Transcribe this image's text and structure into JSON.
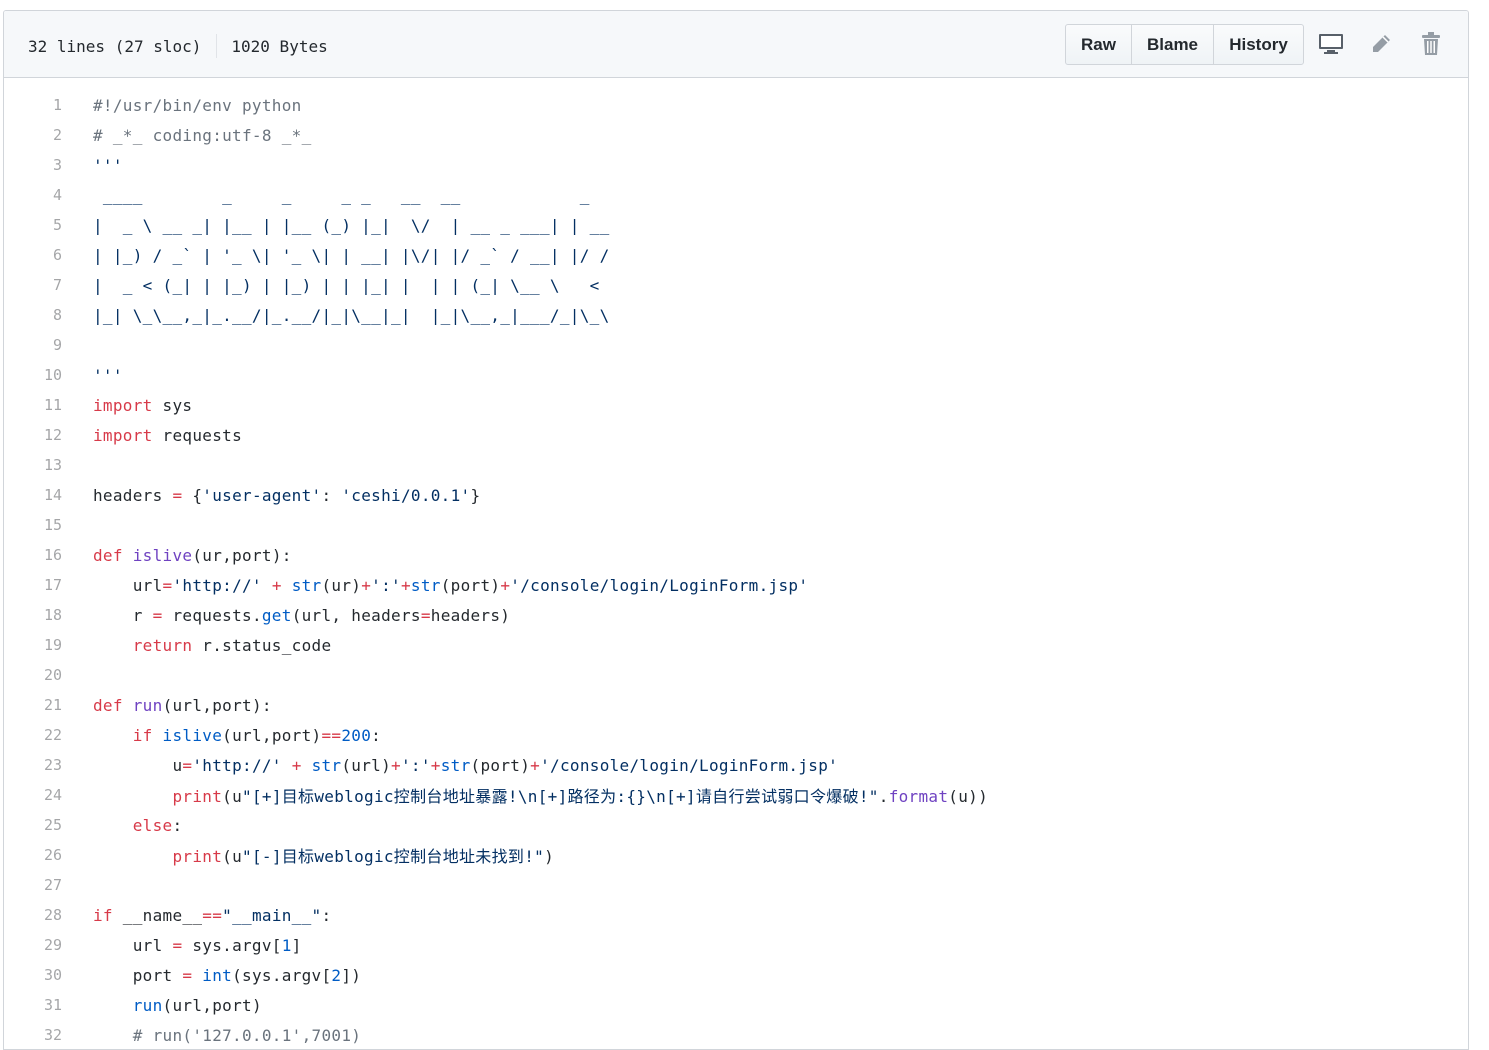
{
  "file_info": {
    "lines": "32 lines (27 sloc)",
    "size": "1020 Bytes"
  },
  "toolbar": {
    "raw": "Raw",
    "blame": "Blame",
    "history": "History"
  },
  "icons": {
    "desktop": "desktop-icon",
    "edit": "pencil-icon",
    "delete": "trash-icon"
  },
  "code_lines": [
    [
      {
        "t": "com",
        "v": "#!/usr/bin/env python"
      }
    ],
    [
      {
        "t": "com",
        "v": "# _*_ coding:utf-8 _*_"
      }
    ],
    [
      {
        "t": "str",
        "v": "'''"
      }
    ],
    [
      {
        "t": "str",
        "v": " ____        _     _     _ _   __  __            _"
      }
    ],
    [
      {
        "t": "str",
        "v": "|  _ \\ __ _| |__ | |__ (_) |_|  \\/  | __ _ ___| | __"
      }
    ],
    [
      {
        "t": "str",
        "v": "| |_) / _` | '_ \\| '_ \\| | __| |\\/| |/ _` / __| |/ /"
      }
    ],
    [
      {
        "t": "str",
        "v": "|  _ < (_| | |_) | |_) | | |_| |  | | (_| \\__ \\   <"
      }
    ],
    [
      {
        "t": "str",
        "v": "|_| \\_\\__,_|_.__/|_.__/|_|\\__|_|  |_|\\__,_|___/_|\\_\\"
      }
    ],
    [],
    [
      {
        "t": "str",
        "v": "'''"
      }
    ],
    [
      {
        "t": "kw",
        "v": "import"
      },
      {
        "t": "",
        "v": " sys"
      }
    ],
    [
      {
        "t": "kw",
        "v": "import"
      },
      {
        "t": "",
        "v": " requests"
      }
    ],
    [],
    [
      {
        "t": "",
        "v": "headers "
      },
      {
        "t": "op",
        "v": "="
      },
      {
        "t": "",
        "v": " {"
      },
      {
        "t": "str",
        "v": "'user-agent'"
      },
      {
        "t": "",
        "v": ": "
      },
      {
        "t": "str",
        "v": "'ceshi/0.0.1'"
      },
      {
        "t": "",
        "v": "}"
      }
    ],
    [],
    [
      {
        "t": "kw",
        "v": "def"
      },
      {
        "t": "",
        "v": " "
      },
      {
        "t": "fn",
        "v": "islive"
      },
      {
        "t": "",
        "v": "(ur,port):"
      }
    ],
    [
      {
        "t": "",
        "v": "    url"
      },
      {
        "t": "op",
        "v": "="
      },
      {
        "t": "str",
        "v": "'http://'"
      },
      {
        "t": "",
        "v": " "
      },
      {
        "t": "op",
        "v": "+"
      },
      {
        "t": "",
        "v": " "
      },
      {
        "t": "bi",
        "v": "str"
      },
      {
        "t": "",
        "v": "(ur)"
      },
      {
        "t": "op",
        "v": "+"
      },
      {
        "t": "str",
        "v": "':'"
      },
      {
        "t": "op",
        "v": "+"
      },
      {
        "t": "bi",
        "v": "str"
      },
      {
        "t": "",
        "v": "(port)"
      },
      {
        "t": "op",
        "v": "+"
      },
      {
        "t": "str",
        "v": "'/console/login/LoginForm.jsp'"
      }
    ],
    [
      {
        "t": "",
        "v": "    r "
      },
      {
        "t": "op",
        "v": "="
      },
      {
        "t": "",
        "v": " requests."
      },
      {
        "t": "bi",
        "v": "get"
      },
      {
        "t": "",
        "v": "(url, headers"
      },
      {
        "t": "op",
        "v": "="
      },
      {
        "t": "",
        "v": "headers)"
      }
    ],
    [
      {
        "t": "",
        "v": "    "
      },
      {
        "t": "kw",
        "v": "return"
      },
      {
        "t": "",
        "v": " r.status_code"
      }
    ],
    [],
    [
      {
        "t": "kw",
        "v": "def"
      },
      {
        "t": "",
        "v": " "
      },
      {
        "t": "fn",
        "v": "run"
      },
      {
        "t": "",
        "v": "(url,port):"
      }
    ],
    [
      {
        "t": "",
        "v": "    "
      },
      {
        "t": "kw",
        "v": "if"
      },
      {
        "t": "",
        "v": " "
      },
      {
        "t": "bi",
        "v": "islive"
      },
      {
        "t": "",
        "v": "(url,port)"
      },
      {
        "t": "op",
        "v": "=="
      },
      {
        "t": "num",
        "v": "200"
      },
      {
        "t": "",
        "v": ":"
      }
    ],
    [
      {
        "t": "",
        "v": "        u"
      },
      {
        "t": "op",
        "v": "="
      },
      {
        "t": "str",
        "v": "'http://'"
      },
      {
        "t": "",
        "v": " "
      },
      {
        "t": "op",
        "v": "+"
      },
      {
        "t": "",
        "v": " "
      },
      {
        "t": "bi",
        "v": "str"
      },
      {
        "t": "",
        "v": "(url)"
      },
      {
        "t": "op",
        "v": "+"
      },
      {
        "t": "str",
        "v": "':'"
      },
      {
        "t": "op",
        "v": "+"
      },
      {
        "t": "bi",
        "v": "str"
      },
      {
        "t": "",
        "v": "(port)"
      },
      {
        "t": "op",
        "v": "+"
      },
      {
        "t": "str",
        "v": "'/console/login/LoginForm.jsp'"
      }
    ],
    [
      {
        "t": "",
        "v": "        "
      },
      {
        "t": "kw",
        "v": "print"
      },
      {
        "t": "",
        "v": "(u"
      },
      {
        "t": "str",
        "v": "\"[+]目标weblogic控制台地址暴露!\\n[+]路径为:{}\\n[+]请自行尝试弱口令爆破!\""
      },
      {
        "t": "",
        "v": "."
      },
      {
        "t": "fn",
        "v": "format"
      },
      {
        "t": "",
        "v": "(u))"
      }
    ],
    [
      {
        "t": "",
        "v": "    "
      },
      {
        "t": "kw",
        "v": "else"
      },
      {
        "t": "",
        "v": ":"
      }
    ],
    [
      {
        "t": "",
        "v": "        "
      },
      {
        "t": "kw",
        "v": "print"
      },
      {
        "t": "",
        "v": "(u"
      },
      {
        "t": "str",
        "v": "\"[-]目标weblogic控制台地址未找到!\""
      },
      {
        "t": "",
        "v": ")"
      }
    ],
    [],
    [
      {
        "t": "kw",
        "v": "if"
      },
      {
        "t": "",
        "v": " __name__"
      },
      {
        "t": "op",
        "v": "=="
      },
      {
        "t": "str",
        "v": "\"__main__\""
      },
      {
        "t": "",
        "v": ":"
      }
    ],
    [
      {
        "t": "",
        "v": "    url "
      },
      {
        "t": "op",
        "v": "="
      },
      {
        "t": "",
        "v": " sys.argv["
      },
      {
        "t": "num",
        "v": "1"
      },
      {
        "t": "",
        "v": "]"
      }
    ],
    [
      {
        "t": "",
        "v": "    port "
      },
      {
        "t": "op",
        "v": "="
      },
      {
        "t": "",
        "v": " "
      },
      {
        "t": "bi",
        "v": "int"
      },
      {
        "t": "",
        "v": "(sys.argv["
      },
      {
        "t": "num",
        "v": "2"
      },
      {
        "t": "",
        "v": "])"
      }
    ],
    [
      {
        "t": "",
        "v": "    "
      },
      {
        "t": "bi",
        "v": "run"
      },
      {
        "t": "",
        "v": "(url,port)"
      }
    ],
    [
      {
        "t": "",
        "v": "    "
      },
      {
        "t": "com",
        "v": "# run('127.0.0.1',7001)"
      }
    ]
  ]
}
